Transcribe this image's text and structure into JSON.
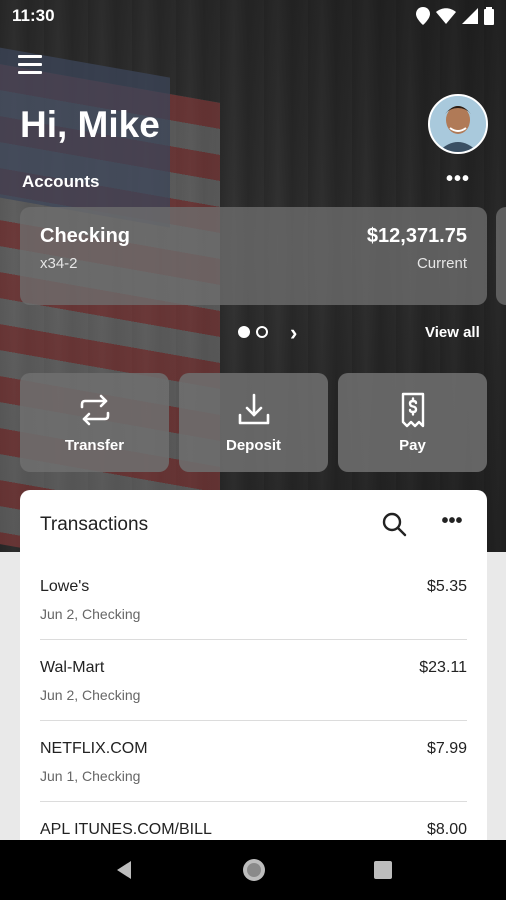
{
  "status_bar": {
    "time": "11:30"
  },
  "header": {
    "greeting": "Hi, Mike",
    "accounts_label": "Accounts",
    "more_label": "•••"
  },
  "account": {
    "name": "Checking",
    "number": "x34-2",
    "balance": "$12,371.75",
    "type": "Current"
  },
  "pager": {
    "view_all": "View all",
    "next": "›"
  },
  "actions": [
    {
      "label": "Transfer",
      "icon": "transfer-icon"
    },
    {
      "label": "Deposit",
      "icon": "deposit-icon"
    },
    {
      "label": "Pay",
      "icon": "pay-icon"
    }
  ],
  "transactions": {
    "title": "Transactions",
    "more_label": "•••",
    "items": [
      {
        "name": "Lowe's",
        "sub": "Jun 2, Checking",
        "amount": "$5.35"
      },
      {
        "name": "Wal-Mart",
        "sub": "Jun 2, Checking",
        "amount": "$23.11"
      },
      {
        "name": "NETFLIX.COM",
        "sub": "Jun 1, Checking",
        "amount": "$7.99"
      },
      {
        "name": "APL ITUNES.COM/BILL",
        "sub": "",
        "amount": "$8.00"
      }
    ]
  }
}
